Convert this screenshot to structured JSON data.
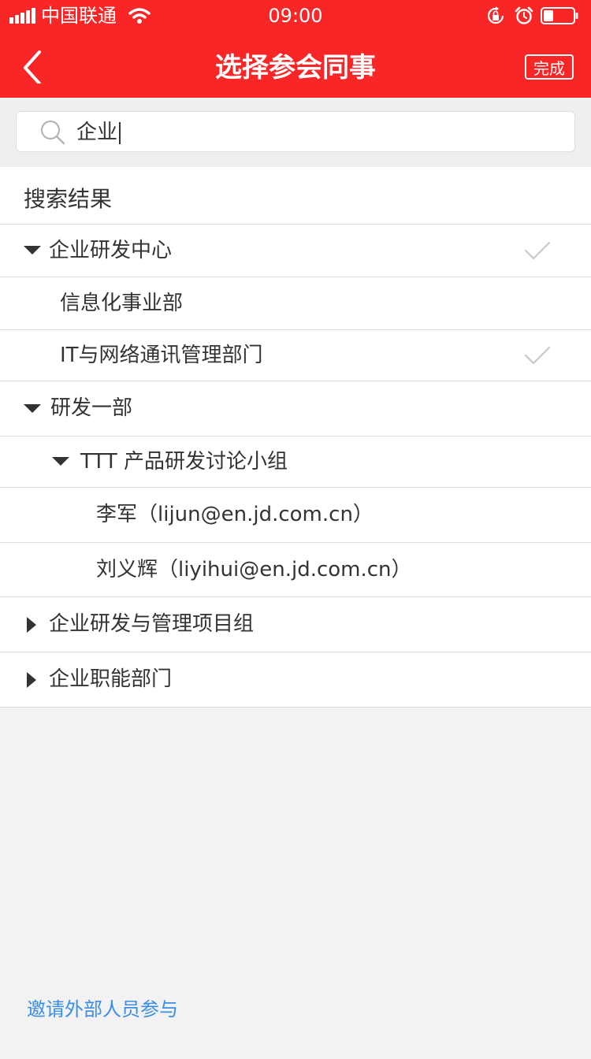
{
  "status_bar": {
    "carrier": "中国联通",
    "time": "09:00"
  },
  "nav": {
    "title": "选择参会同事",
    "done_label": "完成"
  },
  "search": {
    "value": "企业"
  },
  "results": {
    "section_title": "搜索结果",
    "rows": [
      {
        "label": "企业研发中心",
        "level": 0,
        "state": "expanded",
        "checked": true
      },
      {
        "label": "信息化事业部",
        "level": 1,
        "state": "leaf",
        "checked": false
      },
      {
        "label": "IT与网络通讯管理部门",
        "level": 1,
        "state": "leaf",
        "checked": true
      },
      {
        "label": "研发一部",
        "level": 0,
        "state": "expanded",
        "checked": false
      },
      {
        "label": "TTT 产品研发讨论小组",
        "level": 1,
        "state": "expanded",
        "checked": false
      },
      {
        "label": "李军（lijun@en.jd.com.cn）",
        "level": 2,
        "state": "leaf",
        "checked": false
      },
      {
        "label": "刘义辉（liyihui@en.jd.com.cn）",
        "level": 2,
        "state": "leaf",
        "checked": false
      },
      {
        "label": "企业研发与管理项目组",
        "level": 0,
        "state": "collapsed",
        "checked": false
      },
      {
        "label": "企业职能部门",
        "level": 0,
        "state": "collapsed",
        "checked": false
      }
    ]
  },
  "footer": {
    "invite_label": "邀请外部人员参与"
  },
  "colors": {
    "brand": "#f82626",
    "link": "#3a8ee6",
    "check": "#c8c8c8"
  }
}
